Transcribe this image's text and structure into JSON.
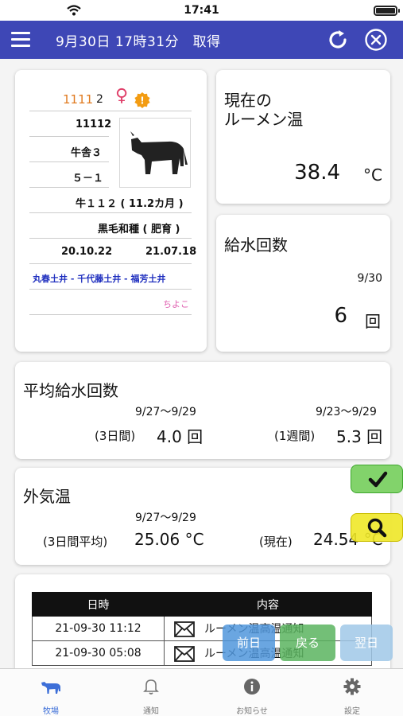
{
  "status_bar": {
    "time": "17:41"
  },
  "header": {
    "title": "9月30日 17時31分　取得"
  },
  "animal": {
    "id_main": "1111",
    "id_suffix": "2",
    "sex_symbol": "♀",
    "alert_symbol": "!",
    "number": "11112",
    "barn": "牛舎３",
    "pen": "５－１",
    "age": "牛１１２ ( 11.2カ月 )",
    "breed": "黒毛和種 ( 肥育 )",
    "date1": "20.10.22",
    "date2": "21.07.18",
    "lineage": "丸春土井 - 千代藤土井 - 福芳土井",
    "nickname": "ちよこ"
  },
  "rumen": {
    "title_line1": "現在の",
    "title_line2": "ルーメン温",
    "value": "38.4",
    "unit": "°C"
  },
  "water": {
    "title": "給水回数",
    "date": "9/30",
    "value": "6",
    "unit": "回"
  },
  "avg_water": {
    "title": "平均給水回数",
    "range1": "9/27～9/29",
    "label1": "(3日間)",
    "value1": "4.0 回",
    "range2": "9/23～9/29",
    "label2": "(1週間)",
    "value2": "5.3 回"
  },
  "outside_temp": {
    "title": "外気温",
    "range": "9/27～9/29",
    "label1": "(3日間平均)",
    "value1": "25.06 °C",
    "label2": "(現在)",
    "value2": "24.54 °C"
  },
  "notifications": {
    "headers": [
      "日時",
      "内容"
    ],
    "rows": [
      {
        "datetime": "21-09-30 11:12",
        "content": "ルーメン温高温通知"
      },
      {
        "datetime": "21-09-30 05:08",
        "content": "ルーメン温高温通知"
      }
    ]
  },
  "buttons": {
    "prev": "前日",
    "back": "戻る",
    "next": "翌日"
  },
  "tabs": [
    {
      "label": "牧場",
      "icon": "cow-icon",
      "active": true
    },
    {
      "label": "通知",
      "icon": "bell-icon",
      "active": false
    },
    {
      "label": "お知らせ",
      "icon": "info-icon",
      "active": false
    },
    {
      "label": "設定",
      "icon": "gear-icon",
      "active": false
    }
  ],
  "colors": {
    "header": "#3e47b6",
    "id_orange": "#e07a1f",
    "female_pink": "#e0406a",
    "lineage_blue": "#1f2fbf",
    "nickname_pink": "#e060b0",
    "tab_active": "#3d6fd8"
  }
}
